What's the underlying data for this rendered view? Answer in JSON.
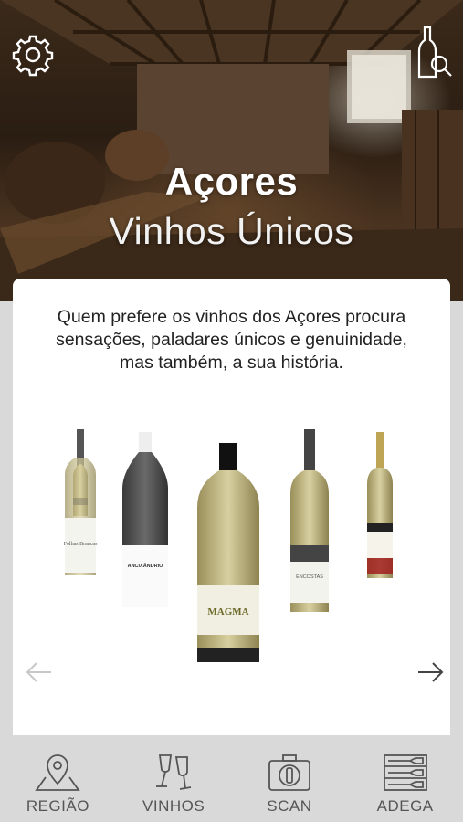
{
  "header": {
    "settings_icon": "gear-icon",
    "search_icon": "bottle-search-icon",
    "title": "Açores",
    "subtitle": "Vinhos Únicos"
  },
  "card": {
    "intro": "Quem prefere os vinhos dos Açores procura sensações, paladares únicos e genuinidade, mas também, a sua história.",
    "bottles": [
      {
        "name": "bottle-1",
        "label_text": "Folhas Brancas"
      },
      {
        "name": "bottle-2",
        "label_text": "ANCIXÂNDRIO"
      },
      {
        "name": "bottle-3",
        "label_text": "MAGMA"
      },
      {
        "name": "bottle-4",
        "label_text": "ENCOSTAS"
      },
      {
        "name": "bottle-5",
        "label_text": ""
      }
    ],
    "prev_icon": "arrow-left-icon",
    "next_icon": "arrow-right-icon"
  },
  "tabs": [
    {
      "label": "REGIÃO",
      "icon": "map-pin-icon"
    },
    {
      "label": "VINHOS",
      "icon": "wine-glasses-icon"
    },
    {
      "label": "SCAN",
      "icon": "camera-icon"
    },
    {
      "label": "ADEGA",
      "icon": "wine-rack-icon"
    }
  ],
  "colors": {
    "tabbar_bg": "#d9d9d9",
    "card_bg": "#ffffff",
    "icon_gray": "#555555"
  }
}
